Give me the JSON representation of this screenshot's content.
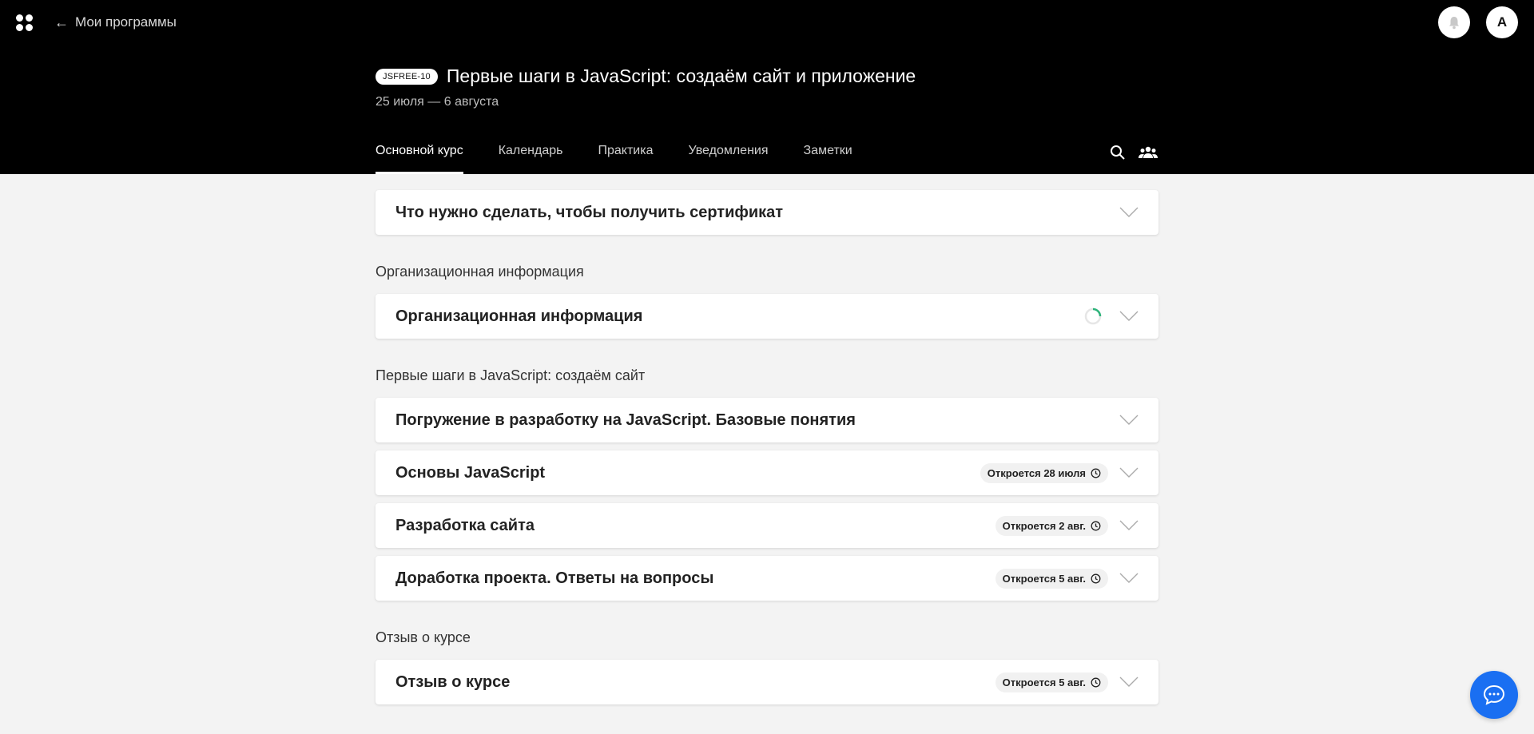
{
  "header": {
    "back_label": "Мои программы",
    "avatar_letter": "А",
    "course_code": "JSFREE-10",
    "course_title": "Первые шаги в JavaScript: создаём сайт и приложение",
    "course_dates": "25 июля — 6 августа",
    "tabs": [
      {
        "label": "Основной курс",
        "active": true
      },
      {
        "label": "Календарь",
        "active": false
      },
      {
        "label": "Практика",
        "active": false
      },
      {
        "label": "Уведомления",
        "active": false
      },
      {
        "label": "Заметки",
        "active": false
      }
    ],
    "icons": [
      "apps-logo-icon",
      "arrow-left-icon",
      "bell-icon",
      "search-icon",
      "people-icon"
    ]
  },
  "content": {
    "certificate_card": {
      "title": "Что нужно сделать, чтобы получить сертификат"
    },
    "sections": [
      {
        "label": "Организационная информация",
        "cards": [
          {
            "title": "Организационная информация",
            "loading": true
          }
        ]
      },
      {
        "label": "Первые шаги в JavaScript: создаём сайт",
        "cards": [
          {
            "title": "Погружение в разработку на JavaScript. Базовые понятия"
          },
          {
            "title": "Основы JavaScript",
            "status": "Откроется 28 июля"
          },
          {
            "title": "Разработка сайта",
            "status": "Откроется 2 авг."
          },
          {
            "title": "Доработка проекта. Ответы на вопросы",
            "status": "Откроется 5 авг."
          }
        ]
      },
      {
        "label": "Отзыв о курсе",
        "cards": [
          {
            "title": "Отзыв о курсе",
            "status": "Откроется 5 авг."
          }
        ]
      }
    ]
  },
  "colors": {
    "header_bg": "#000000",
    "page_bg": "#f3f3f3",
    "chat_button": "#1a6ff2",
    "spinner": "#2db37a"
  }
}
